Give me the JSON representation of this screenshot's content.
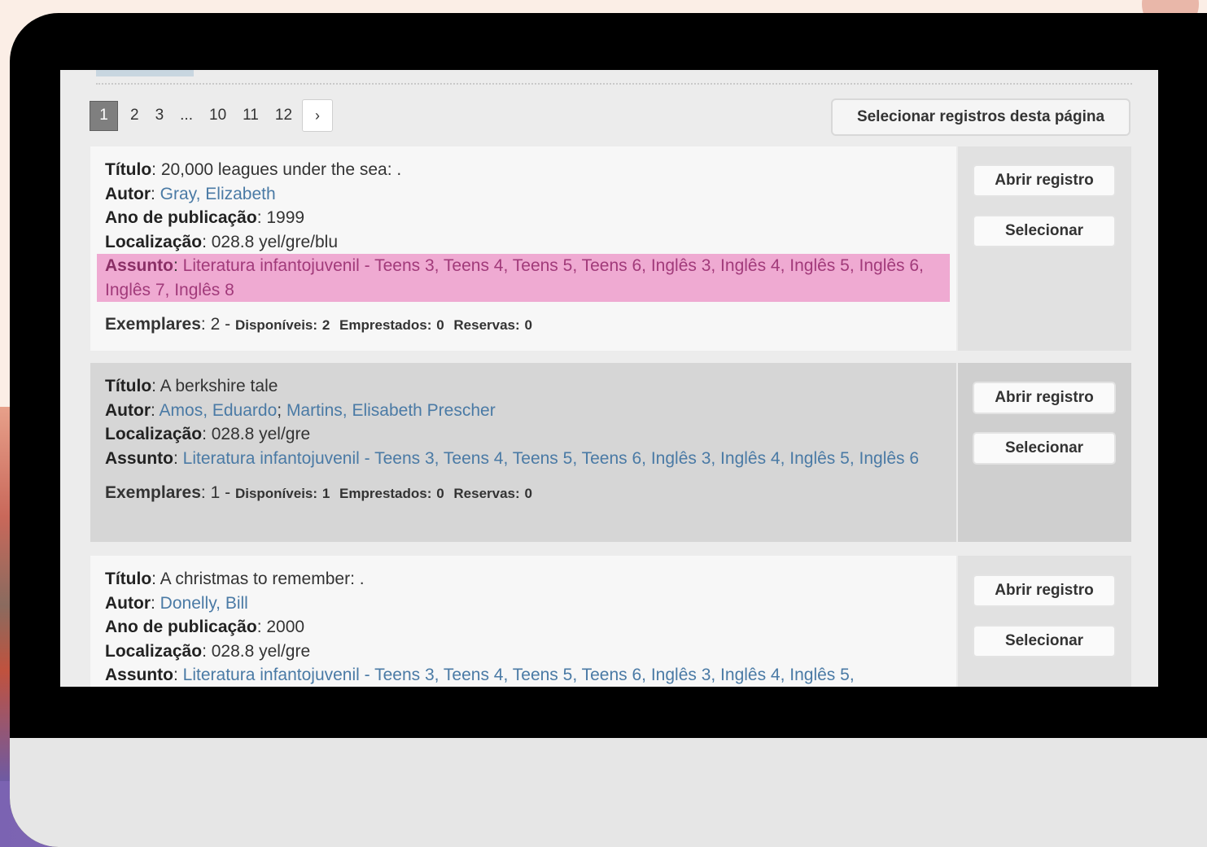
{
  "pagination": {
    "current": "1",
    "pages": [
      "2",
      "3",
      "...",
      "10",
      "11",
      "12"
    ],
    "next_label": "›"
  },
  "select_page_label": "Selecionar registros desta página",
  "labels": {
    "title": "Título",
    "author": "Autor",
    "year": "Ano de publicação",
    "location": "Localização",
    "subject": "Assunto",
    "copies": "Exemplares",
    "available": "Disponíveis",
    "borrowed": "Emprestados",
    "reserves": "Reservas"
  },
  "buttons": {
    "open_record": "Abrir registro",
    "select": "Selecionar"
  },
  "records": [
    {
      "title": "20,000 leagues under the sea: .",
      "authors": [
        "Gray, Elizabeth"
      ],
      "year": "1999",
      "location": "028.8 yel/gre/blu",
      "subject": "Literatura infantojuvenil - Teens 3, Teens 4, Teens 5, Teens 6, Inglês 3, Inglês 4, Inglês 5, Inglês 6, Inglês 7, Inglês 8",
      "copies": "2",
      "available": "2",
      "borrowed": "0",
      "reserves": "0",
      "highlighted": true
    },
    {
      "title": "A berkshire tale",
      "authors": [
        "Amos, Eduardo",
        "Martins, Elisabeth Prescher"
      ],
      "location": "028.8 yel/gre",
      "subject": "Literatura infantojuvenil - Teens 3, Teens 4, Teens 5, Teens 6, Inglês 3, Inglês 4, Inglês 5, Inglês 6",
      "copies": "1",
      "available": "1",
      "borrowed": "0",
      "reserves": "0"
    },
    {
      "title": "A christmas to remember: .",
      "authors": [
        "Donelly, Bill"
      ],
      "year": "2000",
      "location": "028.8 yel/gre",
      "subject": "Literatura infantojuvenil - Teens 3, Teens 4, Teens 5, Teens 6, Inglês 3, Inglês 4, Inglês 5,"
    }
  ],
  "colors": {
    "link": "#4a7aa5",
    "highlight": "#efaad2",
    "record_light": "#f7f7f7",
    "record_dark": "#d6d6d6",
    "side_light": "#e6e6e6",
    "side_dark": "#d0d0d0"
  }
}
